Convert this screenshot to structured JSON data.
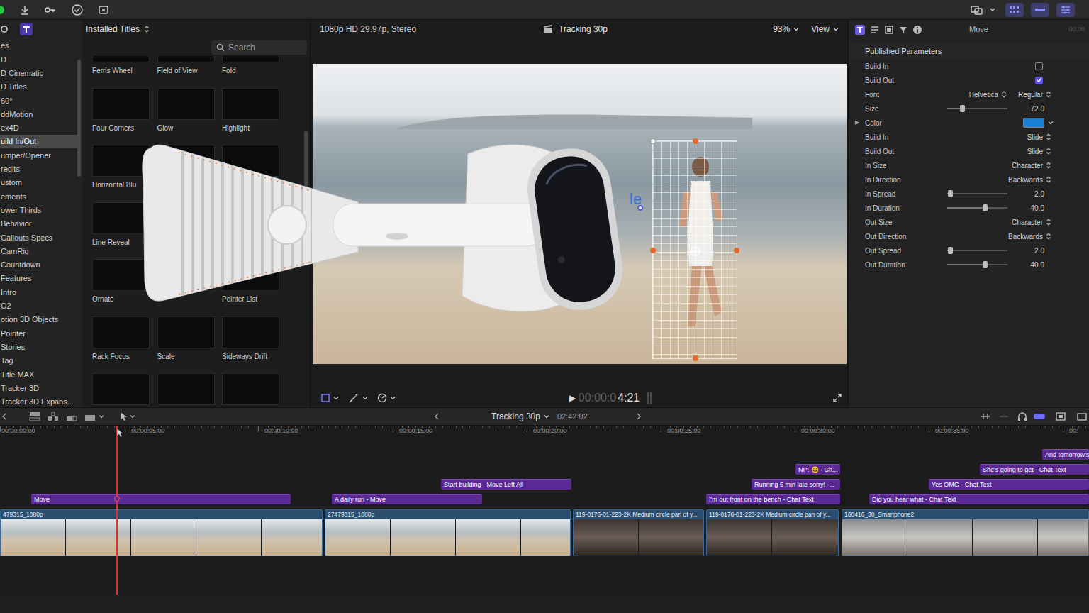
{
  "sidebar": {
    "items": [
      {
        "label": "es",
        "selected": false
      },
      {
        "label": "D",
        "selected": false
      },
      {
        "label": "D Cinematic",
        "selected": false
      },
      {
        "label": "D Titles",
        "selected": false
      },
      {
        "label": "60°",
        "selected": false
      },
      {
        "label": "ddMotion",
        "selected": false
      },
      {
        "label": "ex4D",
        "selected": false
      },
      {
        "label": "uild In/Out",
        "selected": true
      },
      {
        "label": "umper/Opener",
        "selected": false
      },
      {
        "label": "redits",
        "selected": false
      },
      {
        "label": "ustom",
        "selected": false
      },
      {
        "label": "ements",
        "selected": false
      },
      {
        "label": "ower Thirds",
        "selected": false
      },
      {
        "label": "Behavior",
        "selected": false
      },
      {
        "label": "Callouts Specs",
        "selected": false
      },
      {
        "label": "CamRig",
        "selected": false
      },
      {
        "label": "Countdown",
        "selected": false
      },
      {
        "label": "Features",
        "selected": false
      },
      {
        "label": "Intro",
        "selected": false
      },
      {
        "label": "O2",
        "selected": false
      },
      {
        "label": "otion 3D Objects",
        "selected": false
      },
      {
        "label": "Pointer",
        "selected": false
      },
      {
        "label": "Stories",
        "selected": false
      },
      {
        "label": "Tag",
        "selected": false
      },
      {
        "label": "Title MAX",
        "selected": false
      },
      {
        "label": "Tracker 3D",
        "selected": false
      },
      {
        "label": "Tracker 3D Expans...",
        "selected": false
      }
    ]
  },
  "browser": {
    "title": "Installed Titles",
    "search": {
      "placeholder": "Search"
    },
    "thumbnails": [
      {
        "label": "Ferris Wheel"
      },
      {
        "label": "Field of View"
      },
      {
        "label": "Fold"
      },
      {
        "label": "Four Corners"
      },
      {
        "label": "Glow"
      },
      {
        "label": "Highlight"
      },
      {
        "label": "Horizontal Blu"
      },
      {
        "label": ""
      },
      {
        "label": ""
      },
      {
        "label": "Line Reveal"
      },
      {
        "label": ""
      },
      {
        "label": ""
      },
      {
        "label": "Ornate"
      },
      {
        "label": ""
      },
      {
        "label": "Pointer List"
      },
      {
        "label": "Rack Focus"
      },
      {
        "label": "Scale"
      },
      {
        "label": "Sideways Drift"
      },
      {
        "label": ""
      },
      {
        "label": ""
      },
      {
        "label": ""
      }
    ]
  },
  "viewer": {
    "format": "1080p HD 29.97p, Stereo",
    "project": "Tracking 30p",
    "zoom": "93%",
    "view": "View",
    "title_fragment": "le",
    "play": "▶",
    "timecode_dim": "00:00:0",
    "timecode": "4:21"
  },
  "inspector": {
    "tab": "Move",
    "timecode": "00:00",
    "section": "Published Parameters",
    "params": [
      {
        "kind": "checkbox",
        "label": "Build In",
        "checked": false
      },
      {
        "kind": "checkbox",
        "label": "Build Out",
        "checked": true
      },
      {
        "kind": "font",
        "label": "Font",
        "value": "Helvetica",
        "style": "Regular"
      },
      {
        "kind": "slider",
        "label": "Size",
        "level": 0.25,
        "reading": "72.0"
      },
      {
        "kind": "color",
        "label": "Color",
        "disclosure": "▶",
        "color": "#1a7fd4"
      },
      {
        "kind": "popup",
        "label": "Build In",
        "value": "Slide"
      },
      {
        "kind": "popup",
        "label": "Build Out",
        "value": "Slide"
      },
      {
        "kind": "popup",
        "label": "In Size",
        "value": "Character"
      },
      {
        "kind": "popup",
        "label": "In Direction",
        "value": "Backwards"
      },
      {
        "kind": "slider",
        "label": "In Spread",
        "level": 0.05,
        "reading": "2.0"
      },
      {
        "kind": "slider",
        "label": "In Duration",
        "level": 0.62,
        "reading": "40.0"
      },
      {
        "kind": "popup",
        "label": "Out Size",
        "value": "Character"
      },
      {
        "kind": "popup",
        "label": "Out Direction",
        "value": "Backwards"
      },
      {
        "kind": "slider",
        "label": "Out Spread",
        "level": 0.05,
        "reading": "2.0"
      },
      {
        "kind": "slider",
        "label": "Out Duration",
        "level": 0.62,
        "reading": "40.0"
      }
    ]
  },
  "timeline": {
    "project": "Tracking 30p",
    "duration": "02:42:02",
    "ruler": [
      "00:00:00:00",
      "00:00:05:00",
      "00:00:10:00",
      "00:00:15:00",
      "00:00:20:00",
      "00:00:25:00",
      "00:00:30:00",
      "00:00:35:00",
      "00:"
    ],
    "titles": [
      {
        "label": "Move"
      },
      {
        "label": "A daily run - Move"
      },
      {
        "label": "Start building - Move Left All"
      },
      {
        "label": "NP! 😀 - Ch..."
      },
      {
        "label": "Running 5 min late sorry! -..."
      },
      {
        "label": "I'm out front on the bench - Chat Text"
      },
      {
        "label": "And tomorrow's"
      },
      {
        "label": "She's going to get - Chat Text"
      },
      {
        "label": "Yes OMG - Chat Text"
      },
      {
        "label": "Did you hear what - Chat Text"
      }
    ],
    "clips": [
      {
        "label": "479315_1080p"
      },
      {
        "label": "27479315_1080p"
      },
      {
        "label": "119-0176-01-223-2K Medium circle pan of y..."
      },
      {
        "label": "119-0176-01-223-2K Medium circle pan of y..."
      },
      {
        "label": "160416_30_Smartphone2"
      }
    ]
  }
}
